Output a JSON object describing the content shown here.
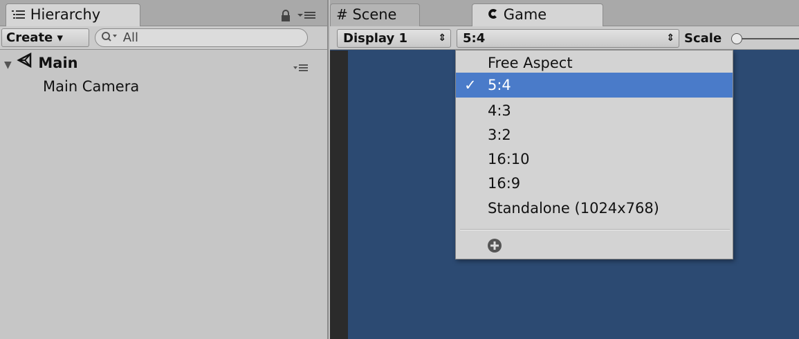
{
  "hierarchy": {
    "tab_label": "Hierarchy",
    "create_label": "Create",
    "search_text": "All",
    "scene_name": "Main",
    "items": [
      "Main Camera"
    ]
  },
  "game_view": {
    "tabs": [
      "Scene",
      "Game"
    ],
    "display_label": "Display 1",
    "aspect_selected": "5:4",
    "scale_label": "Scale",
    "background_color": "#2c4a72"
  },
  "aspect_menu": {
    "items": [
      "Free Aspect",
      "5:4",
      "4:3",
      "3:2",
      "16:10",
      "16:9",
      "Standalone (1024x768)"
    ],
    "selected_index": 1,
    "add_icon": "plus-circle-icon"
  },
  "colors": {
    "selection": "#4a7bc9",
    "panel": "#c6c6c6"
  }
}
